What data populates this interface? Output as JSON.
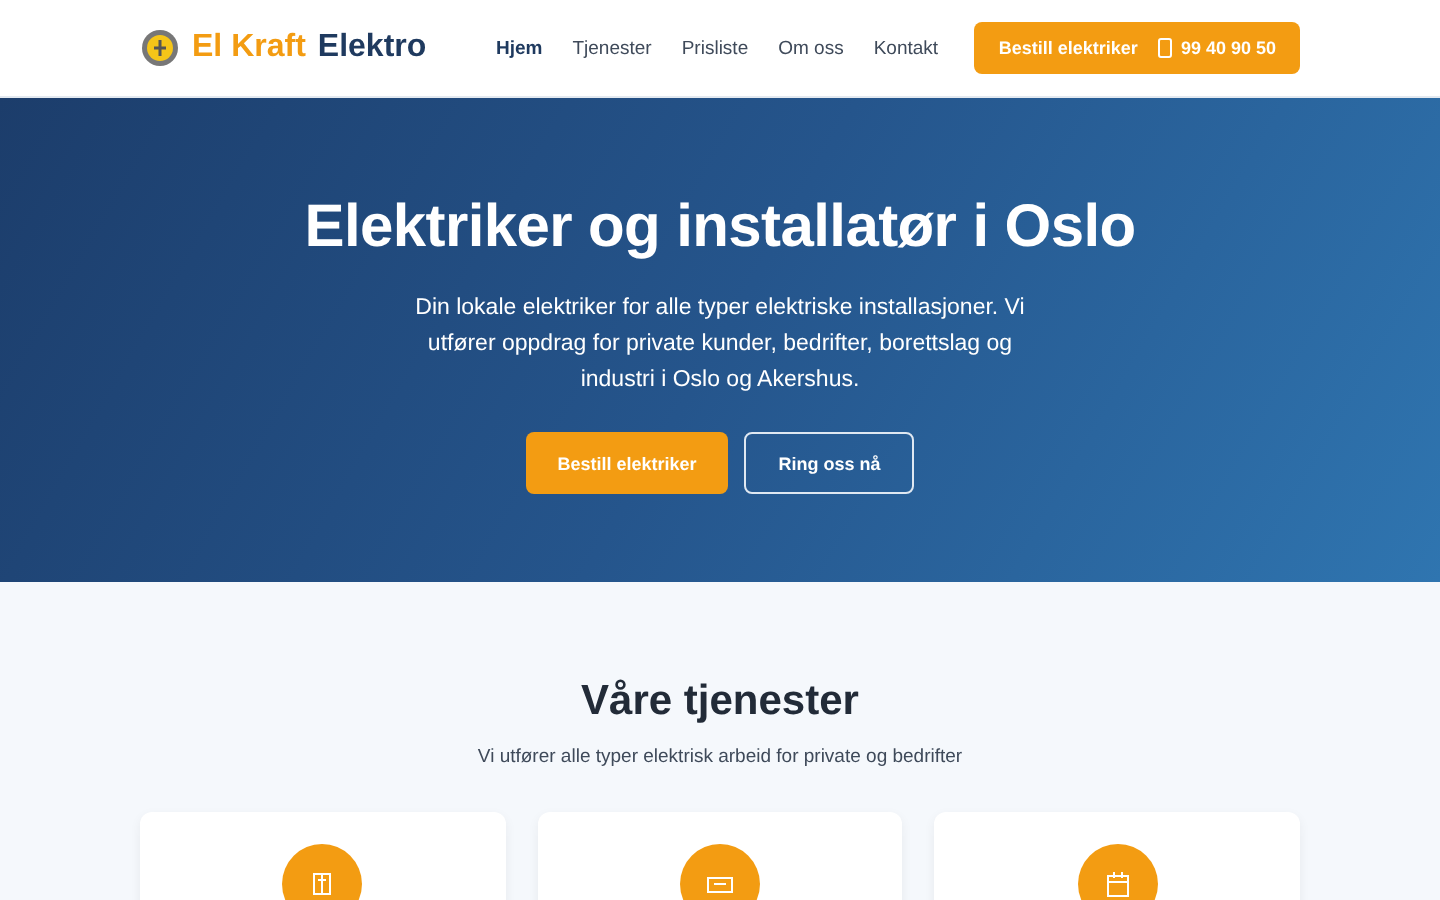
{
  "header": {
    "logo": {
      "part_1": "El Kraft",
      "part_2": "Elektro"
    },
    "nav": [
      {
        "label": "Hjem",
        "selected": true
      },
      {
        "label": "Tjenester",
        "selected": false
      },
      {
        "label": "Prisliste",
        "selected": false
      },
      {
        "label": "Om oss",
        "selected": false
      },
      {
        "label": "Kontakt",
        "selected": false
      }
    ],
    "cta": {
      "label": "Bestill elektriker",
      "phone": "99 40 90 50"
    }
  },
  "hero": {
    "title": "Elektriker og installatør i Oslo",
    "text": "Din lokale elektriker for alle typer elektriske installasjoner. Vi utfører oppdrag for private kunder, bedrifter, borettslag og industri i Oslo og Akershus.",
    "buttons": [
      {
        "label": "Bestill elektriker",
        "kind": "primary"
      },
      {
        "label": "Ring oss nå",
        "kind": "outline"
      }
    ]
  },
  "services": {
    "title": "Våre tjenester",
    "subtitle": "Vi utfører alle typer elektrisk arbeid for private og bedrifter",
    "cards": [
      {
        "kind": "panel"
      },
      {
        "kind": "charger"
      },
      {
        "kind": "calendar"
      }
    ]
  }
}
